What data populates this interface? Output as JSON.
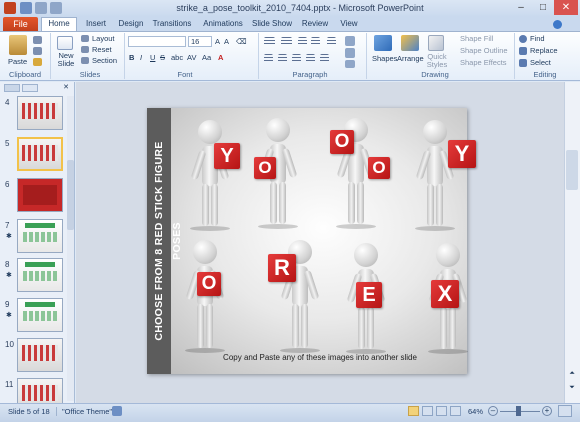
{
  "window": {
    "title": "strike_a_pose_toolkit_2010_7404.pptx - Microsoft PowerPoint"
  },
  "tabs": [
    "File",
    "Home",
    "Insert",
    "Design",
    "Transitions",
    "Animations",
    "Slide Show",
    "Review",
    "View"
  ],
  "ribbon": {
    "clipboard": {
      "paste": "Paste",
      "label": "Clipboard"
    },
    "slides": {
      "new_slide": "New Slide",
      "layout": "Layout",
      "reset": "Reset",
      "section": "Section",
      "label": "Slides"
    },
    "font": {
      "size": "16",
      "label": "Font",
      "bold": "B",
      "italic": "I",
      "underline": "U",
      "strike": "S",
      "shadow": "abc",
      "spacing": "AV",
      "case": "Aa",
      "color": "A"
    },
    "paragraph": {
      "label": "Paragraph"
    },
    "drawing": {
      "shapes": "Shapes",
      "arrange": "Arrange",
      "quick_styles": "Quick Styles",
      "shape_fill": "Shape Fill",
      "shape_outline": "Shape Outline",
      "shape_effects": "Shape Effects",
      "label": "Drawing"
    },
    "editing": {
      "find": "Find",
      "replace": "Replace",
      "select": "Select",
      "label": "Editing"
    }
  },
  "thumbnails": [
    {
      "num": "4",
      "selected": false,
      "star": false
    },
    {
      "num": "5",
      "selected": true,
      "star": false
    },
    {
      "num": "6",
      "selected": false,
      "star": false
    },
    {
      "num": "7",
      "selected": false,
      "star": true
    },
    {
      "num": "8",
      "selected": false,
      "star": true
    },
    {
      "num": "9",
      "selected": false,
      "star": true
    },
    {
      "num": "10",
      "selected": false,
      "star": false
    },
    {
      "num": "11",
      "selected": false,
      "star": false
    }
  ],
  "slide": {
    "band_title": "CHOOSE FROM 8 RED STICK FIGURE POSES",
    "caption": "Copy and Paste any of these images into  another slide",
    "cards": [
      "Y",
      "O",
      "O",
      "O",
      "Y",
      "O",
      "R",
      "E",
      "X"
    ]
  },
  "status": {
    "slide": "Slide 5 of 18",
    "theme": "\"Office Theme\"",
    "zoom": "64%"
  },
  "colors": {
    "file_tab": "#d04a24",
    "card_red": "#d42727",
    "band": "#5c5c5c"
  }
}
